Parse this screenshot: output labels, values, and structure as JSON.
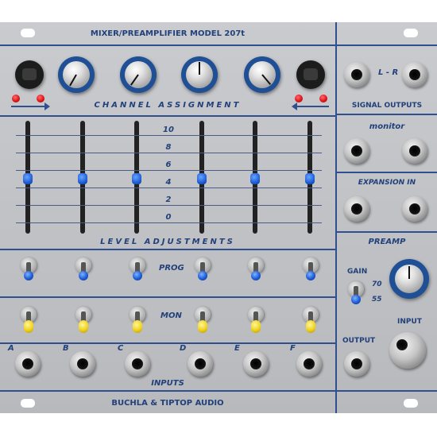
{
  "title": "MIXER/PREAMPLIFIER MODEL 207t",
  "sections": {
    "channel_assignment": "CHANNEL ASSIGNMENT",
    "level_adjustments": "LEVEL ADJUSTMENTS",
    "prog": "PROG",
    "mon": "MON",
    "inputs": "INPUTS"
  },
  "scale": [
    "10",
    "8",
    "6",
    "4",
    "2",
    "0"
  ],
  "input_labels": [
    "A",
    "B",
    "C",
    "D",
    "E",
    "F"
  ],
  "right": {
    "l_r": "L - R",
    "signal_outputs": "SIGNAL OUTPUTS",
    "monitor": "monitor",
    "expansion_in": "EXPANSION IN",
    "preamp": "PREAMP",
    "gain": "GAIN",
    "gain_high": "70",
    "gain_low": "55",
    "output": "OUTPUT",
    "input": "INPUT"
  },
  "brand": "BUCHLA & TIPTOP AUDIO",
  "icons": {
    "jack": "jack-icon",
    "led": "led-icon",
    "arrow": "arrow-icon"
  },
  "colors": {
    "panel": "#c4c6ca",
    "text": "#22407a",
    "knob_ring": "#1f4f94",
    "led": "#e0141a",
    "prog_toggle": "#1c5bd8",
    "mon_toggle": "#f0d21c"
  }
}
